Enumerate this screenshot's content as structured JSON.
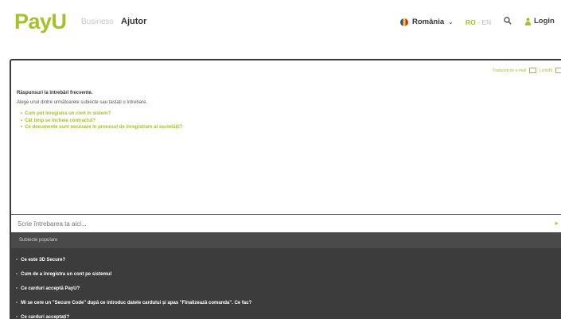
{
  "header": {
    "logo": "PayU",
    "nav": {
      "business": "Business",
      "ajutor": "Ajutor"
    },
    "country": {
      "label": "România",
      "flag_icon": "romania-flag-icon"
    },
    "lang": {
      "ro": "RO",
      "sep": " - ",
      "en": "EN"
    },
    "login": "Login"
  },
  "panel": {
    "tools": {
      "translate": "Traduceți pe e-mail",
      "close": "Lichidă"
    },
    "faq": {
      "title": "Răspunsuri la întrebări frecvente.",
      "subtitle": "Alege unul dintre următoarele subiecte sau tastați o întrebare.",
      "items": [
        "Cum pot înregistra un cont în sistem?",
        "Cât timp se încheie contractul?",
        "Ce documente sunt necesare în procesul de înregistrare al societății?"
      ]
    },
    "input": {
      "placeholder": "Scrie întrebarea ta aici..."
    },
    "topics": {
      "header": "Subiecte populare",
      "items": [
        "Ce este 3D Secure?",
        "Cum de a înregistra un cont pe sistemul",
        "Ce carduri acceptă PayU?",
        "Mi se cere un \"Secure Code\" după ce introduc datele cardului și apas \"Finalizează comanda\". Ce fac?",
        "Ce carduri acceptați?"
      ]
    }
  },
  "colors": {
    "brand": "#a5c229",
    "dark": "#3c3c3c"
  }
}
